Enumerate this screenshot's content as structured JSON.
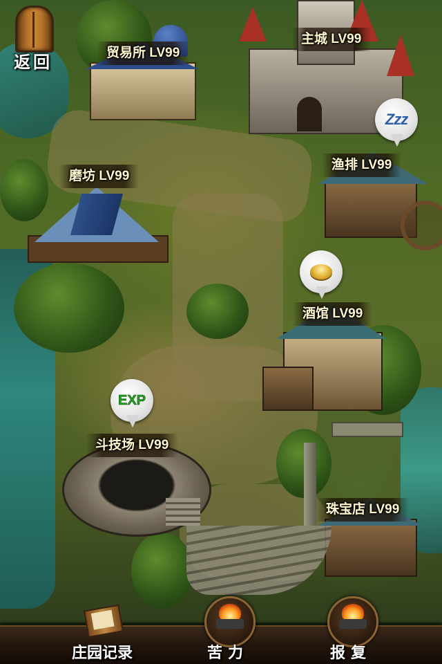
{
  "header": {
    "back_label": "返回"
  },
  "buildings": [
    {
      "id": "trade",
      "label": "贸易所 LV99"
    },
    {
      "id": "castle",
      "label": "主城 LV99"
    },
    {
      "id": "mill",
      "label": "磨坊 LV99"
    },
    {
      "id": "fishery",
      "label": "渔排 LV99"
    },
    {
      "id": "tavern",
      "label": "酒馆 LV99"
    },
    {
      "id": "arena",
      "label": "斗技场 LV99"
    },
    {
      "id": "jewelry",
      "label": "珠宝店 LV99"
    }
  ],
  "status_pins": {
    "fishery": {
      "icon": "sleep-zzz-icon",
      "text": "Zzz"
    },
    "tavern": {
      "icon": "gold-coin-icon"
    },
    "arena": {
      "icon": "exp-icon",
      "text": "EXP"
    }
  },
  "bottom_nav": [
    {
      "label": "庄园记录",
      "icon": "book-quill-icon"
    },
    {
      "label": "苦力",
      "icon": "anvil-fire-icon"
    },
    {
      "label": "报复",
      "icon": "anvil-fire-icon"
    }
  ],
  "colors": {
    "label_text": "#fff6cf",
    "exp_green": "#23a21f",
    "zzz_blue": "#2f5fa8"
  }
}
